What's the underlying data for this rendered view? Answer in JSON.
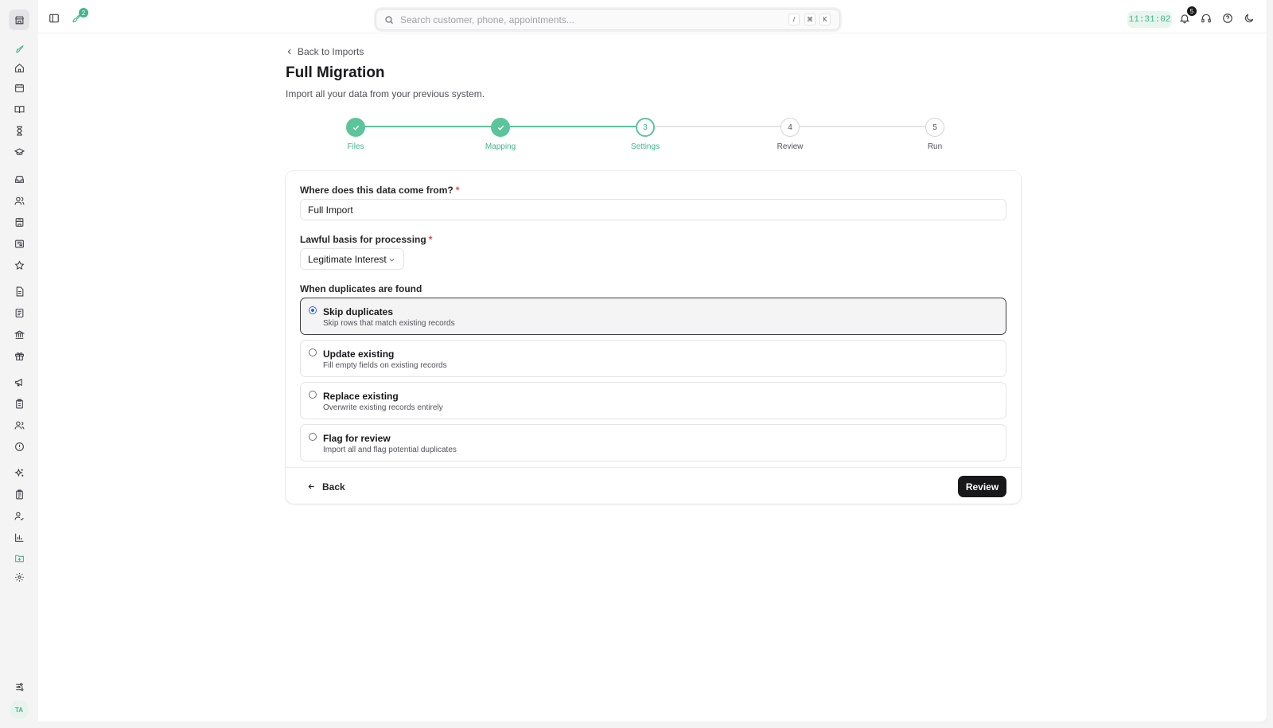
{
  "topbar": {
    "notification_badge_left": "2",
    "search_placeholder": "Search customer, phone, appointments...",
    "shortcut_keys": [
      "/",
      "⌘",
      "K"
    ],
    "clock": "11:31:02",
    "bell_count": "5"
  },
  "sidebar": {
    "avatar_initials": "TA",
    "icons": [
      "rocket-icon",
      "home-icon",
      "calendar-icon",
      "book-icon",
      "hourglass-icon",
      "graduation-cap-icon",
      "inbox-icon",
      "users-icon",
      "store-icon",
      "newspaper-icon",
      "star-icon",
      "file-icon",
      "receipt-icon",
      "bank-icon",
      "gift-icon",
      "megaphone-icon",
      "clipboard-icon",
      "team-icon",
      "alert-circle-icon",
      "sparkles-icon",
      "clipboard-list-icon",
      "user-check-icon",
      "bar-chart-icon",
      "folder-import-icon",
      "settings-icon",
      "sliders-icon"
    ],
    "active_icon": "folder-import-icon"
  },
  "page": {
    "back_link": "Back to Imports",
    "title": "Full Migration",
    "subtitle": "Import all your data from your previous system."
  },
  "stepper": {
    "steps": [
      {
        "label": "Files",
        "number": "1",
        "state": "done"
      },
      {
        "label": "Mapping",
        "number": "2",
        "state": "done"
      },
      {
        "label": "Settings",
        "number": "3",
        "state": "current"
      },
      {
        "label": "Review",
        "number": "4",
        "state": "upcoming"
      },
      {
        "label": "Run",
        "number": "5",
        "state": "upcoming"
      }
    ]
  },
  "form": {
    "source_label": "Where does this data come from?",
    "source_value": "Full Import",
    "lawful_label": "Lawful basis for processing",
    "lawful_value": "Legitimate Interest",
    "required_mark": "*",
    "duplicates_label": "When duplicates are found",
    "options": [
      {
        "title": "Skip duplicates",
        "desc": "Skip rows that match existing records",
        "selected": true
      },
      {
        "title": "Update existing",
        "desc": "Fill empty fields on existing records",
        "selected": false
      },
      {
        "title": "Replace existing",
        "desc": "Overwrite existing records entirely",
        "selected": false
      },
      {
        "title": "Flag for review",
        "desc": "Import all and flag potential duplicates",
        "selected": false
      }
    ],
    "back_button": "Back",
    "review_button": "Review"
  },
  "colors": {
    "accent": "#3fb68b",
    "step_done": "#5cc49b",
    "primary_button": "#18181b",
    "radio_selected": "#2563eb",
    "required": "#ef4444"
  }
}
